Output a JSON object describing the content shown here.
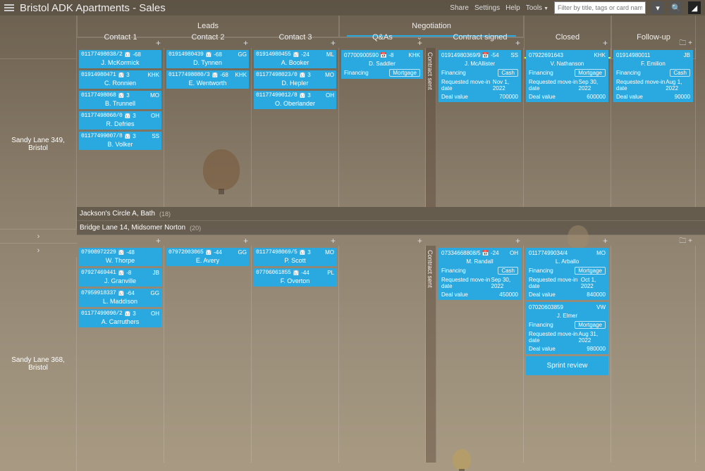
{
  "app": {
    "title": "Bristol ADK Apartments - Sales"
  },
  "top": {
    "links": [
      "Share",
      "Settings",
      "Help",
      "Tools"
    ],
    "search_placeholder": "Filter by title, tags or card name"
  },
  "groups": {
    "leads": "Leads",
    "negotiation": "Negotiation",
    "closed": "Closed",
    "followup": "Follow-up"
  },
  "columns": {
    "c1": "Contact 1",
    "c2": "Contact 2",
    "c3": "Contact 3",
    "qa": "Q&As",
    "signed": "Contract signed",
    "sent": "Contract sent"
  },
  "lanes": {
    "sl349": "Sandy Lane 349, Bristol",
    "jackson": "Jackson's Circle A, Bath",
    "jackson_count": "(18)",
    "bridge": "Bridge Lane 14, Midsomer Norton",
    "bridge_count": "(20)",
    "sl368": "Sandy Lane 368, Bristol"
  },
  "cards": {
    "sl349": {
      "c1": [
        {
          "phone": "01177498038/2",
          "d": "-68",
          "init": "",
          "name": "J. McKormick"
        },
        {
          "phone": "01914980471",
          "d": "3",
          "init": "KHK",
          "name": "C. Ronnien"
        },
        {
          "phone": "01177498068",
          "d": "3",
          "init": "MO",
          "name": "B. Trunnell"
        },
        {
          "phone": "01177498060/0",
          "d": "3",
          "init": "OH",
          "name": "R. Defries"
        },
        {
          "phone": "01177499007/8",
          "d": "3",
          "init": "SS",
          "name": "B. Volker"
        }
      ],
      "c2": [
        {
          "phone": "01914980439",
          "d": "-68",
          "init": "GG",
          "name": "D. Tynnen"
        },
        {
          "phone": "01177498080/3",
          "d": "-68",
          "init": "KHK",
          "name": "E. Wentworth"
        }
      ],
      "c3": [
        {
          "phone": "01914980455",
          "d": "-24",
          "init": "ML",
          "name": "A. Booker"
        },
        {
          "phone": "01177498023/0",
          "d": "3",
          "init": "MO",
          "name": "D. Hepler"
        },
        {
          "phone": "01177499012/8",
          "d": "3",
          "init": "OH",
          "name": "O. Oberlander"
        }
      ],
      "qa": [
        {
          "phone": "07700900590",
          "d": "-8",
          "init": "KHK",
          "name": "D. Saddler",
          "rows": [
            {
              "l": "Financing",
              "r": "Mortgage",
              "pill": true
            }
          ]
        }
      ],
      "signed": [
        {
          "phone": "01914980369/9",
          "d": "-54",
          "init": "SS",
          "name": "J. McAllister",
          "rows": [
            {
              "l": "Financing",
              "r": "Cash",
              "pill": true
            },
            {
              "l": "Requested move-in date",
              "r": "Nov 1, 2022"
            },
            {
              "l": "Deal value",
              "r": "700000"
            }
          ]
        }
      ],
      "closed": [
        {
          "phone": "07922691643",
          "d": "",
          "init": "KHK",
          "name": "V. Nathanson",
          "rows": [
            {
              "l": "Financing",
              "r": "Mortgage",
              "pill": true
            },
            {
              "l": "Requested move-in date",
              "r": "Sep 30, 2022"
            },
            {
              "l": "Deal value",
              "r": "600000"
            }
          ]
        }
      ],
      "follow": [
        {
          "phone": "01914980011",
          "d": "",
          "init": "JB",
          "name": "F. Emilion",
          "rows": [
            {
              "l": "Financing",
              "r": "Cash",
              "pill": true
            },
            {
              "l": "Requested move-in date",
              "r": "Aug 1, 2022"
            },
            {
              "l": "Deal value",
              "r": "90000"
            }
          ]
        }
      ]
    },
    "sl368": {
      "c1": [
        {
          "phone": "07908972229",
          "d": "-48",
          "init": "",
          "name": "W. Thorpe"
        },
        {
          "phone": "07927469441",
          "d": "-8",
          "init": "JB",
          "name": "J. Granville"
        },
        {
          "phone": "07959918337",
          "d": "-64",
          "init": "GG",
          "name": "L. Maddison"
        },
        {
          "phone": "01177499090/2",
          "d": "3",
          "init": "OH",
          "name": "A. Carruthers"
        }
      ],
      "c2": [
        {
          "phone": "07972003065",
          "d": "-44",
          "init": "GG",
          "name": "E. Avery"
        }
      ],
      "c3": [
        {
          "phone": "01177498069/5",
          "d": "3",
          "init": "MO",
          "name": "P. Scott"
        },
        {
          "phone": "07706061855",
          "d": "-44",
          "init": "PL",
          "name": "F. Overton"
        }
      ],
      "signed": [
        {
          "phone": "07334668808/5",
          "d": "-24",
          "init": "OH",
          "name": "M. Randall",
          "rows": [
            {
              "l": "Financing",
              "r": "Cash",
              "pill": true
            },
            {
              "l": "Requested move-in date",
              "r": "Sep 30, 2022"
            },
            {
              "l": "Deal value",
              "r": "450000"
            }
          ]
        }
      ],
      "closed": [
        {
          "phone": "01177499034/4",
          "d": "",
          "init": "MO",
          "name": "L. Arballo",
          "rows": [
            {
              "l": "Financing",
              "r": "Mortgage",
              "pill": true
            },
            {
              "l": "Requested move-in date",
              "r": "Oct 1, 2022"
            },
            {
              "l": "Deal value",
              "r": "840000"
            }
          ]
        },
        {
          "phone": "07020603859",
          "d": "",
          "init": "VW",
          "name": "J. Elmer",
          "rows": [
            {
              "l": "Financing",
              "r": "Mortgage",
              "pill": true
            },
            {
              "l": "Requested move-in date",
              "r": "Aug 31, 2022"
            },
            {
              "l": "Deal value",
              "r": "980000"
            }
          ]
        }
      ],
      "sprint": "Sprint review"
    }
  }
}
